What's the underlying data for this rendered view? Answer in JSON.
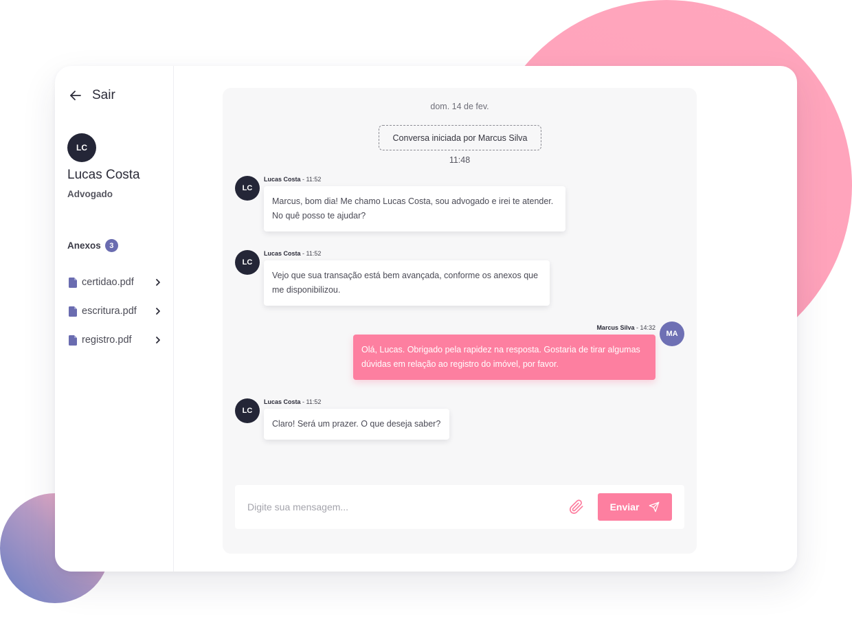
{
  "sidebar": {
    "back_label": "Sair",
    "user": {
      "initials": "LC",
      "name": "Lucas Costa",
      "role": "Advogado"
    },
    "attachments": {
      "title": "Anexos",
      "count": "3",
      "files": [
        {
          "name": "certidao.pdf"
        },
        {
          "name": "escritura.pdf"
        },
        {
          "name": "registro.pdf"
        }
      ]
    }
  },
  "chat": {
    "date": "dom. 14 de fev.",
    "started_label": "Conversa iniciada por Marcus Silva",
    "started_time": "11:48",
    "messages": [
      {
        "author": "Lucas Costa",
        "time": "11:52",
        "initials": "LC",
        "direction": "in",
        "text": "Marcus, bom dia! Me chamo Lucas Costa, sou advogado e irei te atender. No quê posso te ajudar?"
      },
      {
        "author": "Lucas Costa",
        "time": "11:52",
        "initials": "LC",
        "direction": "in",
        "text": "Vejo que sua transação está bem avançada, conforme os anexos que me disponibilizou."
      },
      {
        "author": "Marcus Silva",
        "time": "14:32",
        "initials": "MA",
        "direction": "out",
        "text": "Olá, Lucas. Obrigado pela rapidez na resposta. Gostaria de tirar algumas dúvidas em relação ao registro do imóvel, por favor."
      },
      {
        "author": "Lucas Costa",
        "time": "11:52",
        "initials": "LC",
        "direction": "in",
        "text": "Claro! Será um prazer. O que deseja saber?"
      }
    ],
    "meta_separator": " - "
  },
  "composer": {
    "placeholder": "Digite sua mensagem...",
    "value": "",
    "attach_icon": "paperclip-icon",
    "send_label": "Enviar",
    "send_icon": "send-icon"
  },
  "colors": {
    "accent_pink": "#fd7fa0",
    "accent_purple": "#6a6cb0",
    "avatar_dark": "#242637"
  }
}
